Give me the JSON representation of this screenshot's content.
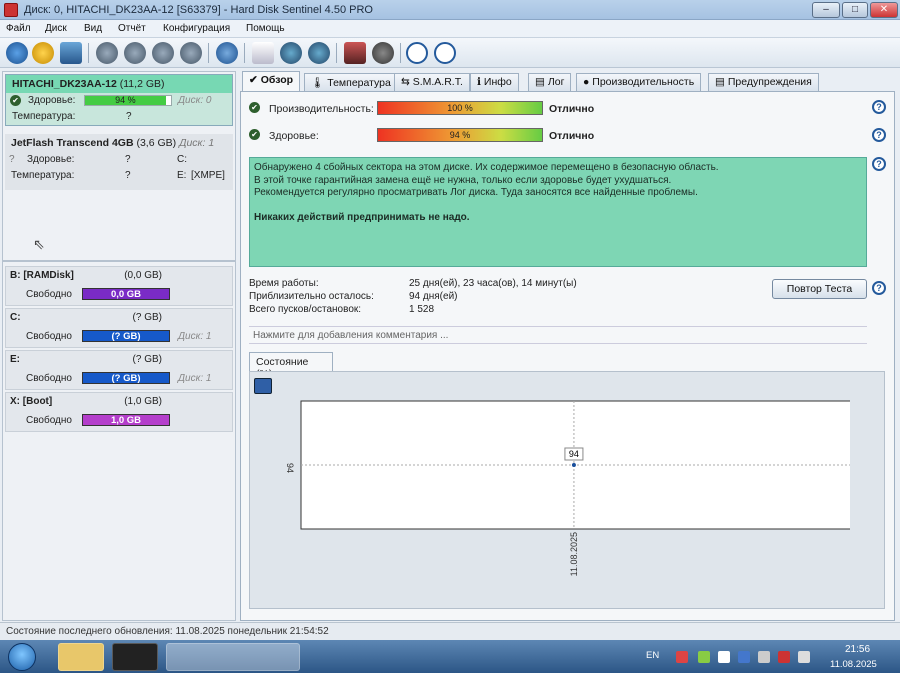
{
  "window": {
    "title": "Диск: 0, HITACHI_DK23AA-12 [S63379]  -  Hard Disk Sentinel 4.50 PRO",
    "min": "–",
    "max": "□",
    "close": "✕"
  },
  "menu": [
    "Файл",
    "Диск",
    "Вид",
    "Отчёт",
    "Конфигурация",
    "Помощь"
  ],
  "toolbar_icons": [
    "refresh-icon",
    "warning-icon",
    "disk-icon",
    "tool-icon",
    "tool-icon",
    "tool-icon",
    "tool-icon",
    "globe-icon",
    "report-icon",
    "settings-icon",
    "network-icon",
    "alert-icon",
    "sound-icon",
    "help-icon",
    "info-icon"
  ],
  "disks": [
    {
      "name": "HITACHI_DK23AA-12",
      "size": "(11,2 GB)",
      "health_label": "Здоровье:",
      "health": "94 %",
      "health_pct": 94,
      "disk": "Диск: 0",
      "temp_label": "Температура:",
      "temp": "?"
    },
    {
      "name": "JetFlash Transcend 4GB",
      "size": "(3,6 GB)",
      "disk": "Диск: 1",
      "health_label": "Здоровье:",
      "health": "?",
      "drive": "C:",
      "temp_label": "Температура:",
      "temp": "?",
      "drive2": "E:",
      "xmpe": "[XMPE]"
    }
  ],
  "volumes": [
    {
      "name": "B: [RAMDisk]",
      "size": "(0,0 GB)",
      "free_label": "Свободно",
      "free": "0,0 GB",
      "color": "#7a2bc6",
      "disk": ""
    },
    {
      "name": "C:",
      "size": "(? GB)",
      "free_label": "Свободно",
      "free": "(? GB)",
      "color": "#1659c9",
      "disk": "Диск: 1"
    },
    {
      "name": "E:",
      "size": "(? GB)",
      "free_label": "Свободно",
      "free": "(? GB)",
      "color": "#1659c9",
      "disk": "Диск: 1"
    },
    {
      "name": "X: [Boot]",
      "size": "(1,0 GB)",
      "free_label": "Свободно",
      "free": "1,0 GB",
      "color": "#b43ecb",
      "disk": ""
    }
  ],
  "tabs": [
    "Обзор",
    "Температура",
    "S.M.A.R.T.",
    "Инфо",
    "Лог",
    "Производительность",
    "Предупреждения"
  ],
  "overview": {
    "perf_label": "Производительность:",
    "perf": "100 %",
    "perf_pct": 100,
    "perf_status": "Отлично",
    "health_label": "Здоровье:",
    "health": "94 %",
    "health_pct": 94,
    "health_status": "Отлично",
    "message": [
      "Обнаружено 4 сбойных сектора на этом диске. Их содержимое перемещено в безопасную область.",
      "В этой точке гарантийная замена ещё не нужна, только если здоровье будет ухудшаться.",
      "Рекомендуется регулярно просматривать Лог диска. Туда заносятся все найденные проблемы."
    ],
    "action": "Никаких действий предпринимать не надо.",
    "uptime_label": "Время работы:",
    "uptime": "25 дня(ей), 23 часа(ов), 14 минут(ы)",
    "remaining_label": "Приблизительно осталось:",
    "remaining": "94 дня(ей)",
    "starts_label": "Всего пусков/остановок:",
    "starts": "1 528",
    "retest": "Повтор Теста",
    "comment": "Нажмите для добавления комментария ...",
    "state_tab": "Состояние (%)"
  },
  "chart_data": {
    "type": "line",
    "x": [
      "11.08.2025"
    ],
    "values": [
      94
    ],
    "ytick": "94",
    "point_label": "94"
  },
  "status": "Состояние последнего обновления: 11.08.2025 понедельник 21:54:52",
  "tray": {
    "lang": "EN",
    "time": "21:56",
    "date": "11.08.2025"
  }
}
